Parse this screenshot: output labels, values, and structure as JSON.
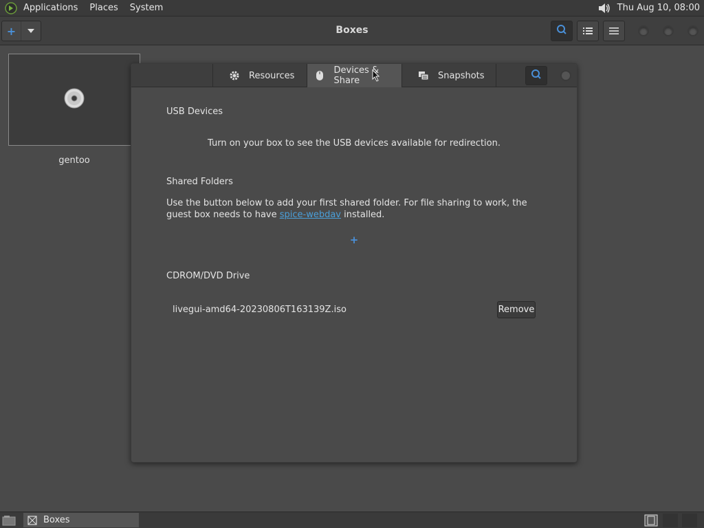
{
  "top_panel": {
    "menus": [
      "Applications",
      "Places",
      "System"
    ],
    "clock": "Thu Aug 10, 08:00",
    "icons": {
      "logo": "gnome-foot-icon",
      "volume": "volume-icon"
    }
  },
  "header": {
    "title": "Boxes",
    "new_button_icon": "plus-icon",
    "accent": "#4a90d9"
  },
  "boxes": [
    {
      "name": "gentoo",
      "icon": "cdrom-icon"
    }
  ],
  "dialog": {
    "tabs": [
      {
        "label": "Resources",
        "icon": "gear-icon",
        "selected": false
      },
      {
        "label": "Devices & Share",
        "icon": "mouse-icon",
        "selected": true
      },
      {
        "label": "Snapshots",
        "icon": "snapshot-icon",
        "selected": false
      }
    ],
    "usb": {
      "title": "USB Devices",
      "message": "Turn on your box to see the USB devices available for redirection."
    },
    "shared": {
      "title": "Shared Folders",
      "desc_before": "Use the button below to add your first shared folder. For file sharing to work, the guest box needs to have ",
      "link": "spice-webdav",
      "desc_after": " installed.",
      "link_color": "#4a9fd9"
    },
    "cdrom": {
      "title": "CDROM/DVD Drive",
      "iso": "livegui-amd64-20230806T163139Z.iso",
      "remove_label": "Remove"
    }
  },
  "taskbar": {
    "task_label": "Boxes"
  }
}
